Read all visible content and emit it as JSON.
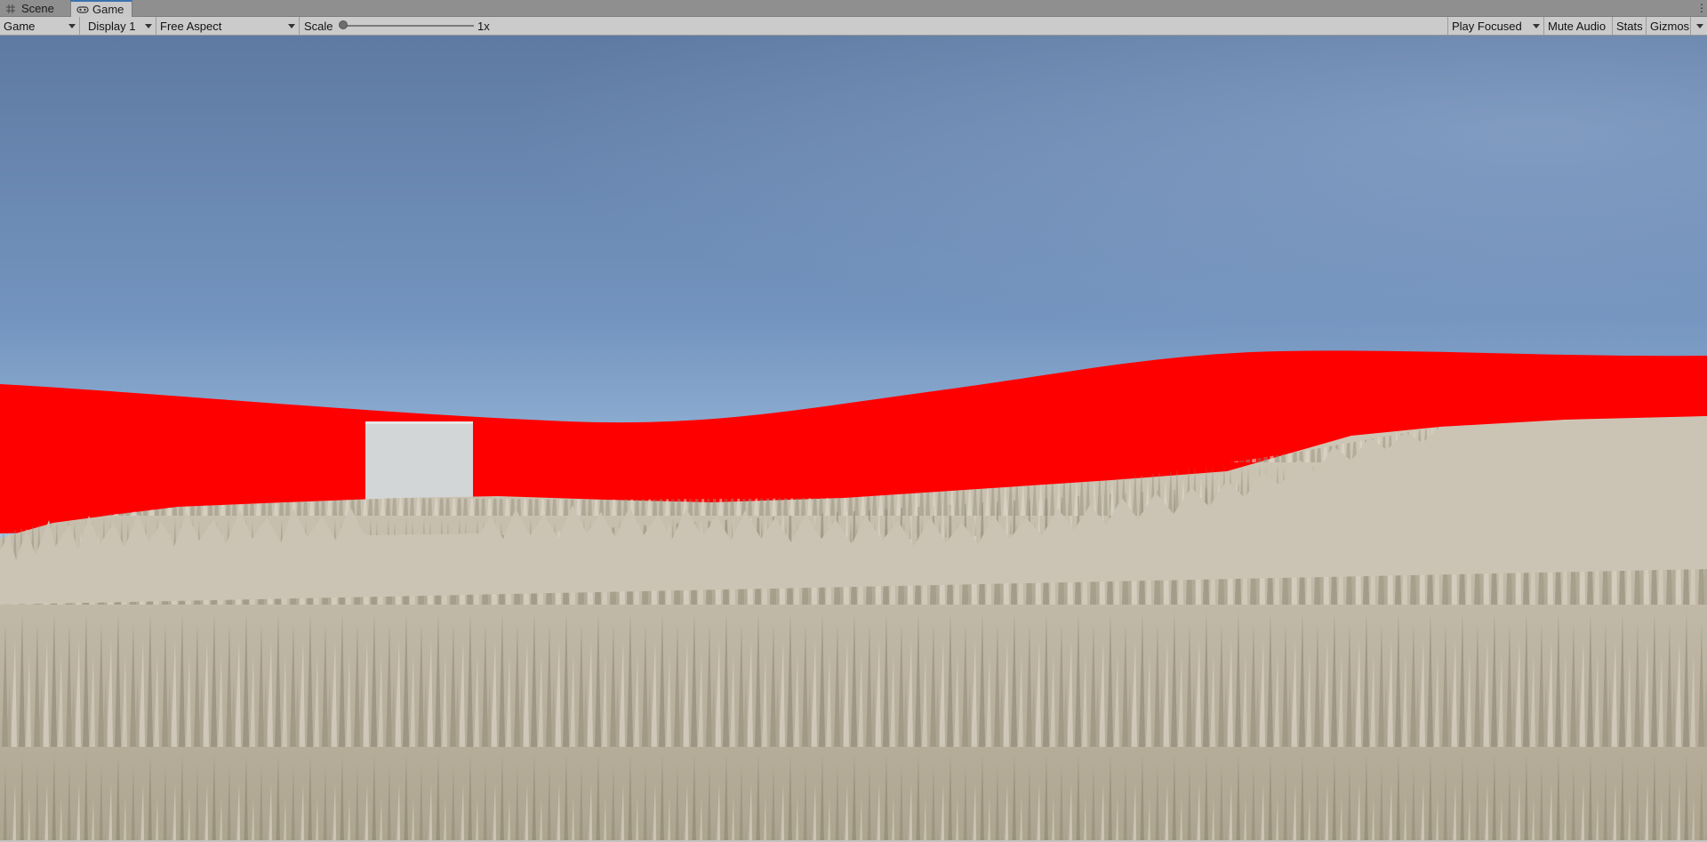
{
  "tabs": {
    "scene_label": "Scene",
    "game_label": "Game"
  },
  "toolbar": {
    "game_view": "Game",
    "display": "Display 1",
    "aspect": "Free Aspect",
    "scale_label": "Scale",
    "scale_value": "1x",
    "scale_slider_fraction": 0.0,
    "play_mode": "Play Focused",
    "mute_audio": "Mute Audio",
    "stats": "Stats",
    "gizmos": "Gizmos"
  },
  "colors": {
    "sky_top": "#5f7ba3",
    "sky_horizon": "#cfe7f7",
    "red_hill": "#ff0000",
    "grass_light": "#c9c1b1",
    "grass_dark": "#8a8470",
    "cube": "#d2d5d6",
    "accent_tab": "#3a72b0"
  }
}
